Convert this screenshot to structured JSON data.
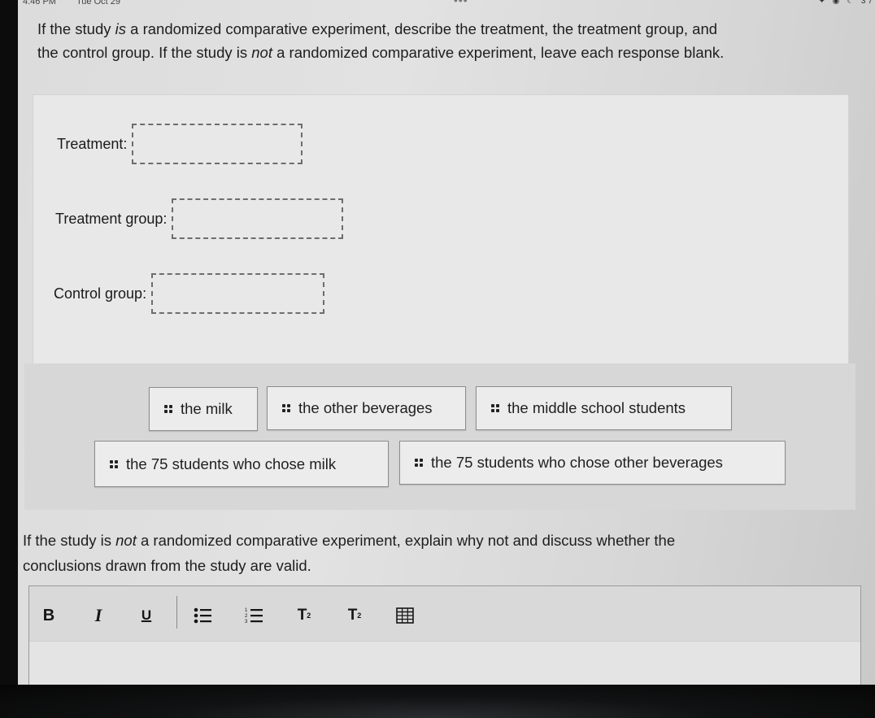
{
  "status_bar": {
    "time": "4:46 PM",
    "date": "Tue Oct 29",
    "center_dots": "•••",
    "right_icons": "✦ ◉ ☾ 37"
  },
  "intro": {
    "part1": "If the study ",
    "emph1": "is",
    "part2": " a randomized comparative experiment, describe the treatment, the treatment group, and the control group. If the study is ",
    "emph2": "not",
    "part3": " a randomized comparative experiment, leave each response blank."
  },
  "fields": [
    {
      "label": "Treatment:",
      "value": ""
    },
    {
      "label": "Treatment group:",
      "value": ""
    },
    {
      "label": "Control group:",
      "value": ""
    }
  ],
  "answer_bank": [
    {
      "label": "the milk"
    },
    {
      "label": "the other beverages"
    },
    {
      "label": "the middle school students"
    },
    {
      "label": "the 75 students who chose milk"
    },
    {
      "label": "the 75 students who chose other beverages"
    }
  ],
  "prompt2": {
    "part1": "If the study is ",
    "emph": "not",
    "part2": " a randomized comparative experiment, explain why not and discuss whether the conclusions drawn from the study are valid."
  },
  "editor": {
    "toolbar": {
      "bold": "B",
      "italic": "I",
      "underline": "U",
      "bullet_list_icon": "bulleted-list",
      "numbered_list_icon": "numbered-list",
      "superscript": "T",
      "superscript_mark": "2",
      "subscript": "T",
      "subscript_mark": "2",
      "table_icon": "table"
    },
    "content": ""
  }
}
